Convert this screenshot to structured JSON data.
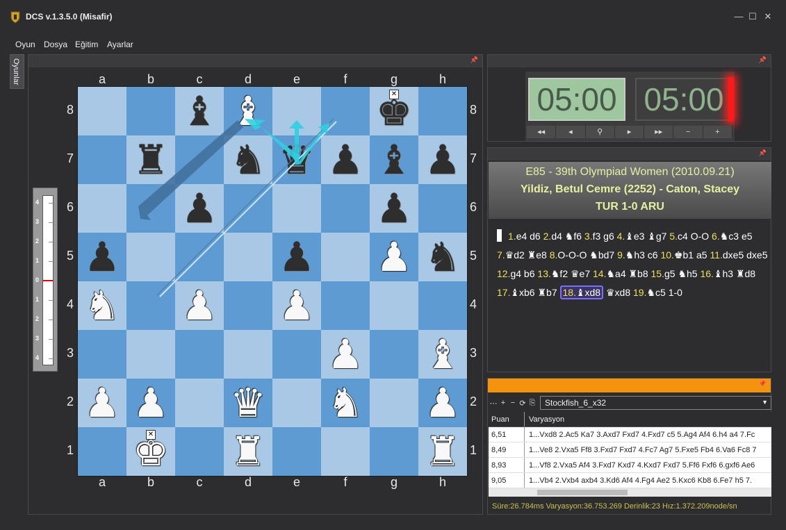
{
  "window": {
    "title": "DCS v.1.3.5.0 (Misafir)",
    "controls": [
      "—",
      "☐",
      "✕"
    ]
  },
  "menu": [
    "Oyun",
    "Dosya",
    "Eğitim",
    "Ayarlar"
  ],
  "side_tab": "Oyunlar",
  "board": {
    "files": [
      "a",
      "b",
      "c",
      "d",
      "e",
      "f",
      "g",
      "h"
    ],
    "ranks": [
      "8",
      "7",
      "6",
      "5",
      "4",
      "3",
      "2",
      "1"
    ],
    "position": [
      [
        "",
        "",
        "b-bishop",
        "w-bishop",
        "",
        "",
        "b-king",
        ""
      ],
      [
        "",
        "b-rook",
        "",
        "b-knight",
        "b-queen",
        "b-pawn",
        "b-bishop",
        "b-pawn"
      ],
      [
        "",
        "",
        "b-pawn",
        "",
        "",
        "",
        "b-pawn",
        ""
      ],
      [
        "b-pawn",
        "",
        "",
        "",
        "b-pawn",
        "",
        "w-pawn",
        "b-knight"
      ],
      [
        "w-knight",
        "",
        "w-pawn",
        "",
        "w-pawn",
        "",
        "",
        ""
      ],
      [
        "",
        "",
        "",
        "",
        "",
        "w-pawn",
        "",
        "w-bishop"
      ],
      [
        "w-pawn",
        "w-pawn",
        "",
        "w-queen",
        "",
        "w-knight",
        "",
        "w-pawn"
      ],
      [
        "",
        "w-king",
        "",
        "w-rook",
        "",
        "",
        "",
        "w-rook"
      ]
    ],
    "glyphs": {
      "king": "♚",
      "queen": "♛",
      "rook": "♜",
      "bishop": "♝",
      "knight": "♞",
      "pawn": "♟"
    },
    "check_marks": [
      "g8",
      "b1"
    ]
  },
  "eval_scale": [
    "4",
    "3",
    "2",
    "1",
    "0",
    "1",
    "2",
    "3",
    "4"
  ],
  "clock": {
    "white": "05:00",
    "black": "05:00",
    "buttons": [
      "◂◂",
      "◂",
      "⚲",
      "▸",
      "▸▸",
      "−",
      "+"
    ]
  },
  "game": {
    "event": "E85 - 39th Olympiad Women (2010.09.21)",
    "players": "Yildiz, Betul Cemre (2252) - Caton, Stacey",
    "result": "TUR 1-0 ARU",
    "moves": [
      {
        "n": "1.",
        "m": "e4 d6"
      },
      {
        "n": "2.",
        "m": "d4 ♞f6"
      },
      {
        "n": "3.",
        "m": "f3 g6"
      },
      {
        "n": "4.",
        "m": "♝e3 ♝g7"
      },
      {
        "n": "5.",
        "m": "c4 O-O"
      },
      {
        "n": "6.",
        "m": "♞c3 e5"
      },
      {
        "n": "7.",
        "m": "♛d2 ♜e8"
      },
      {
        "n": "8.",
        "m": "O-O-O ♞bd7"
      },
      {
        "n": "9.",
        "m": "♞h3 c6"
      },
      {
        "n": "10.",
        "m": "♚b1 a5"
      },
      {
        "n": "11.",
        "m": "dxe5 dxe5"
      },
      {
        "n": "12.",
        "m": "g4 b6"
      },
      {
        "n": "13.",
        "m": "♞f2 ♛e7"
      },
      {
        "n": "14.",
        "m": "♞a4 ♜b8"
      },
      {
        "n": "15.",
        "m": "g5 ♞h5"
      },
      {
        "n": "16.",
        "m": "♝h3 ♜d8"
      },
      {
        "n": "17.",
        "m": "♝xb6"
      },
      {
        "n": "",
        "m": "♜b7"
      },
      {
        "n": "18.",
        "m": "♝xd8",
        "current": true
      },
      {
        "n": "",
        "m": "♛xd8"
      },
      {
        "n": "19.",
        "m": "♞c5"
      },
      {
        "n": "",
        "m": "1-0"
      }
    ]
  },
  "engine": {
    "toolbar": [
      "⋯",
      "+",
      "−",
      "⟳",
      "⎘"
    ],
    "name": "Stockfish_6_x32",
    "headers": {
      "score": "Puan",
      "line": "Varyasyon"
    },
    "rows": [
      {
        "score": "6,51",
        "line": "1...Vxd8 2.Ac5 Ka7 3.Axd7 Fxd7 4.Fxd7 c5 5.Ag4 Af4 6.h4 a4 7.Fc"
      },
      {
        "score": "8,49",
        "line": "1...Ve8 2.Vxa5 Ff8 3.Fxd7 Fxd7 4.Fc7 Ag7 5.Fxe5 Fb4 6.Va6 Fc8 7"
      },
      {
        "score": "8,93",
        "line": "1...Vf8 2.Vxa5 Af4 3.Fxd7 Kxd7 4.Kxd7 Fxd7 5.Ff6 Fxf6 6.gxf6 Ae6"
      },
      {
        "score": "9,05",
        "line": "1...Vb4 2.Vxb4 axb4 3.Kd6 Af4 4.Fg4 Ae2 5.Kxc6 Kb8 6.Fe7 h5 7."
      }
    ],
    "status": "Süre:26.784ms Varyasyon:36.753.269 Derinlik:23 Hız:1.372.209node/sn"
  }
}
